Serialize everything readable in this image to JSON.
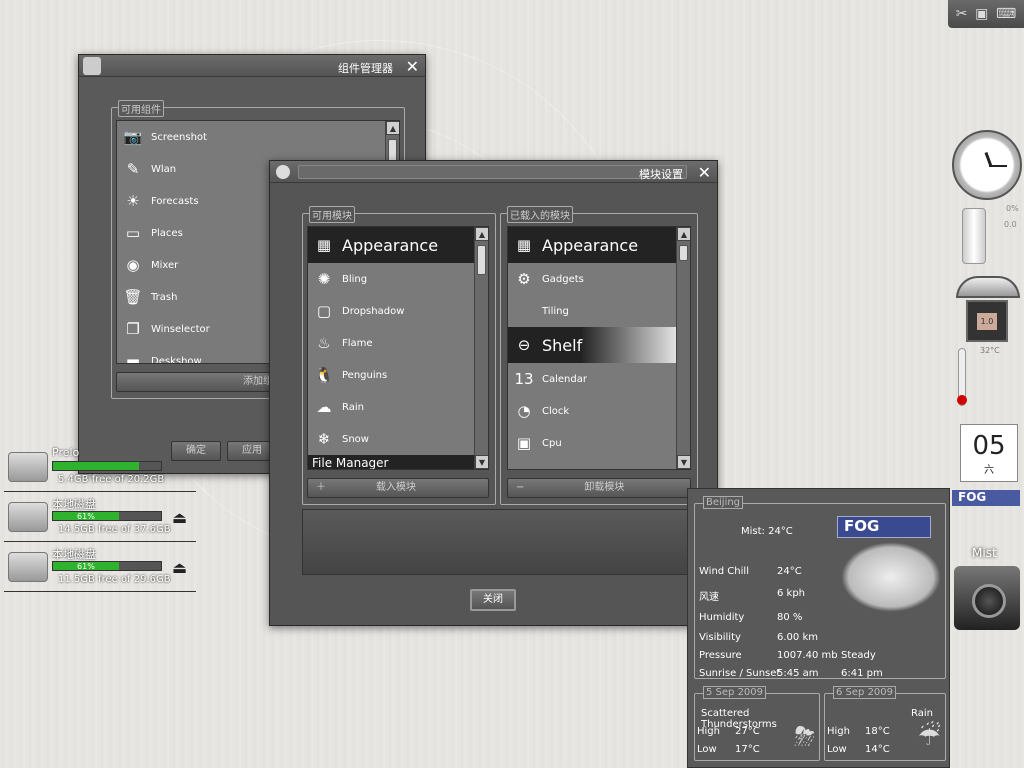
{
  "tray": {
    "icons": [
      "tools-icon",
      "monitor-icon",
      "keyboard-icon"
    ]
  },
  "gadget_manager": {
    "title": "组件管理器",
    "group_label": "可用组件",
    "items": [
      {
        "label": "Screenshot",
        "icon": "camera-icon",
        "glyph": "📷"
      },
      {
        "label": "Wlan",
        "icon": "wlan-icon",
        "glyph": "✎"
      },
      {
        "label": "Forecasts",
        "icon": "sun-icon",
        "glyph": "☀"
      },
      {
        "label": "Places",
        "icon": "drive-icon",
        "glyph": "▭"
      },
      {
        "label": "Mixer",
        "icon": "speaker-icon",
        "glyph": "◉"
      },
      {
        "label": "Trash",
        "icon": "trash-icon",
        "glyph": "🗑"
      },
      {
        "label": "Winselector",
        "icon": "windows-icon",
        "glyph": "❐"
      },
      {
        "label": "Deskshow",
        "icon": "desktop-icon",
        "glyph": "▬"
      }
    ],
    "add_button": "添加组",
    "ok_button": "确定",
    "apply_button": "应用"
  },
  "module_settings": {
    "title": "模块设置",
    "available_label": "可用模块",
    "loaded_label": "已载入的模块",
    "available": {
      "header": "Appearance",
      "items": [
        {
          "label": "Bling",
          "icon": "bling-icon",
          "glyph": "✺"
        },
        {
          "label": "Dropshadow",
          "icon": "dropshadow-icon",
          "glyph": "▢"
        },
        {
          "label": "Flame",
          "icon": "flame-icon",
          "glyph": "♨"
        },
        {
          "label": "Penguins",
          "icon": "penguin-icon",
          "glyph": "🐧"
        },
        {
          "label": "Rain",
          "icon": "rain-icon",
          "glyph": "☁"
        },
        {
          "label": "Snow",
          "icon": "snow-icon",
          "glyph": "❄"
        }
      ],
      "footer": "File Manager"
    },
    "loaded": {
      "header": "Appearance",
      "items": [
        {
          "label": "Gadgets",
          "icon": "gadgets-icon",
          "glyph": "⚙"
        },
        {
          "label": "Tiling",
          "icon": "",
          "glyph": ""
        }
      ],
      "section": "Shelf",
      "items2": [
        {
          "label": "Calendar",
          "icon": "calendar-icon",
          "glyph": "13"
        },
        {
          "label": "Clock",
          "icon": "clock-icon",
          "glyph": "◔"
        },
        {
          "label": "Cpu",
          "icon": "cpu-icon",
          "glyph": "▣"
        }
      ]
    },
    "load_button": "载入模块",
    "unload_button": "卸载模块",
    "close_button": "关闭"
  },
  "drives": [
    {
      "name": "Prelo",
      "percent_text": "",
      "percent": 0.8,
      "free": "5.4GB free of 20.2GB"
    },
    {
      "name": "本地磁盘",
      "percent_text": "61%",
      "percent": 0.61,
      "free": "14.5GB free of 37.6GB"
    },
    {
      "name": "本地磁盘",
      "percent_text": "61%",
      "percent": 0.61,
      "free": "11.5GB free of 29.6GB"
    }
  ],
  "right_gadgets": {
    "cpu_pct": "0%",
    "mem": "0.0",
    "cpu_label": "1.0",
    "temp": "32°C",
    "calendar_day": "05",
    "calendar_weekday": "六",
    "weather_mini": "Mist",
    "fog_label": "FOG"
  },
  "weather": {
    "city": "Beijing",
    "current": "Mist: 24°C",
    "badge": "FOG",
    "rows": [
      {
        "label": "Wind Chill",
        "value": "24°C",
        "extra": ""
      },
      {
        "label": "风速",
        "value": "6 kph",
        "extra": ""
      },
      {
        "label": "Humidity",
        "value": "80 %",
        "extra": ""
      },
      {
        "label": "Visibility",
        "value": "6.00 km",
        "extra": ""
      },
      {
        "label": "Pressure",
        "value": "1007.40 mb",
        "extra": "Steady"
      },
      {
        "label": "Sunrise / Sunset",
        "value": "5:45 am",
        "extra": "6:41 pm"
      }
    ],
    "forecast": [
      {
        "date": "5 Sep 2009",
        "cond": "Scattered Thunderstorms",
        "high_label": "High",
        "high": "27°C",
        "low_label": "Low",
        "low": "17°C"
      },
      {
        "date": "6 Sep 2009",
        "cond": "Rain",
        "high_label": "High",
        "high": "18°C",
        "low_label": "Low",
        "low": "14°C"
      }
    ]
  }
}
